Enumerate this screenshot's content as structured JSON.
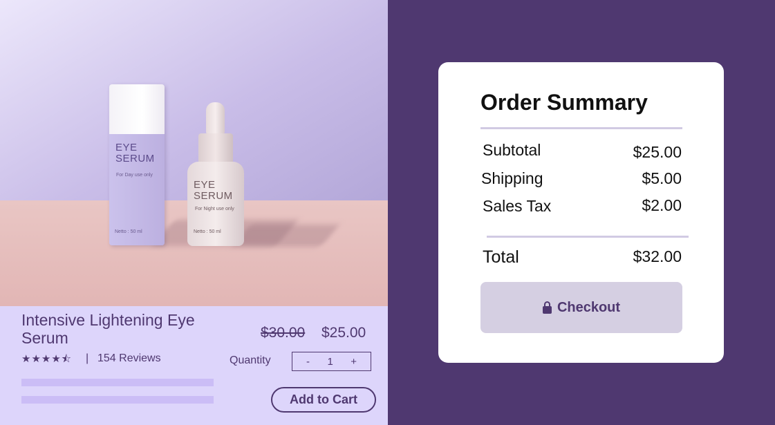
{
  "product": {
    "box_label_title": "EYE\nSERUM",
    "box_label_sub": "For Day use only",
    "box_label_volume": "Netto : 50 ml",
    "bottle_label_title": "EYE\nSERUM",
    "bottle_label_sub": "For Night use only",
    "bottle_label_volume": "Netto : 50 ml",
    "name": "Intensive Lightening Eye Serum",
    "rating": 4.5,
    "rating_max": 5,
    "stars_display": "★★★★⯪",
    "review_separator": "|",
    "reviews_text": "154 Reviews",
    "old_price": "$30.00",
    "price": "$25.00",
    "quantity_label": "Quantity",
    "quantity_minus": "-",
    "quantity_value": "1",
    "quantity_plus": "+",
    "add_to_cart_label": "Add to Cart"
  },
  "order_summary": {
    "title": "Order Summary",
    "subtotal_label": "Subtotal",
    "subtotal_value": "$25.00",
    "shipping_label": "Shipping",
    "shipping_value": "$5.00",
    "tax_label": "Sales Tax",
    "tax_value": "$2.00",
    "total_label": "Total",
    "total_value": "$32.00",
    "checkout_label": "Checkout",
    "checkout_icon": "lock-icon"
  },
  "colors": {
    "accent": "#4f3870",
    "left_panel_bg": "#ddd5fb",
    "placeholder_bar": "#cbbdf6",
    "checkout_bg": "#d5cfe2"
  }
}
